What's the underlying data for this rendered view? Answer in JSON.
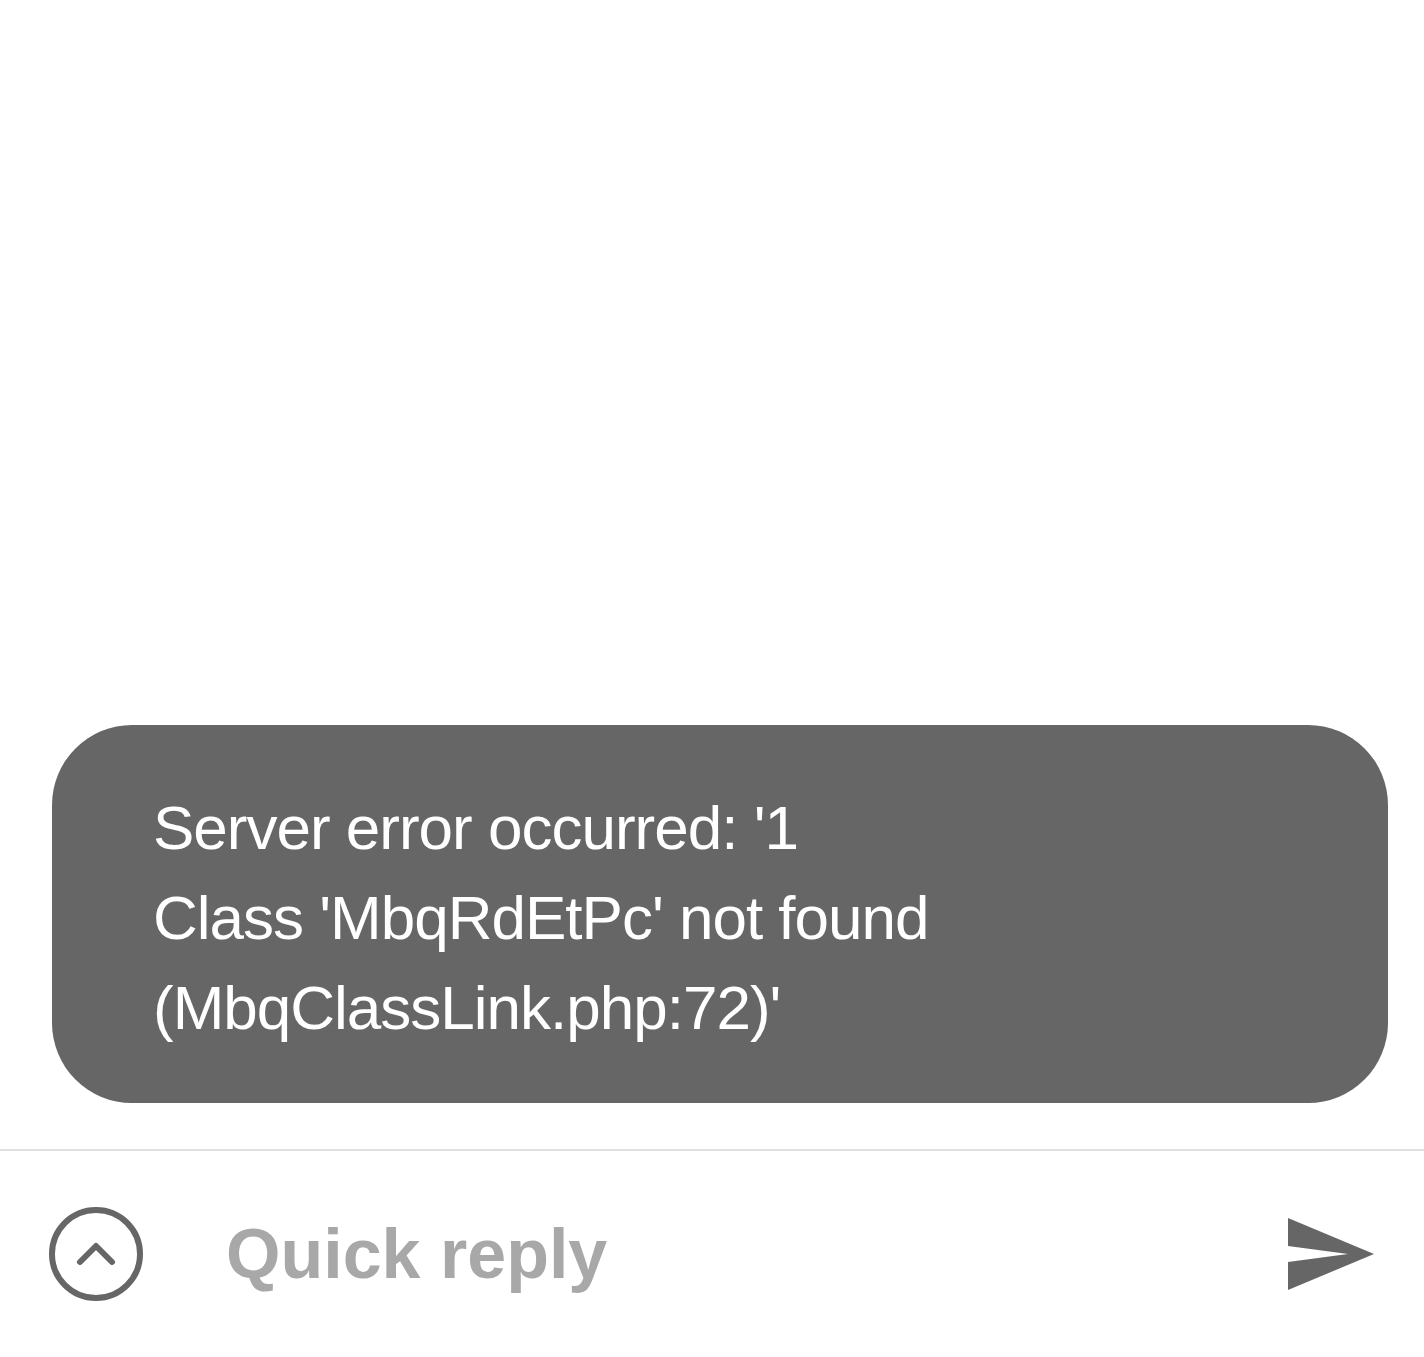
{
  "toast": {
    "message": "Server error occurred: '1\nClass 'MbqRdEtPc' not found\n(MbqClassLink.php:72)'"
  },
  "reply_bar": {
    "placeholder": "Quick reply"
  }
}
